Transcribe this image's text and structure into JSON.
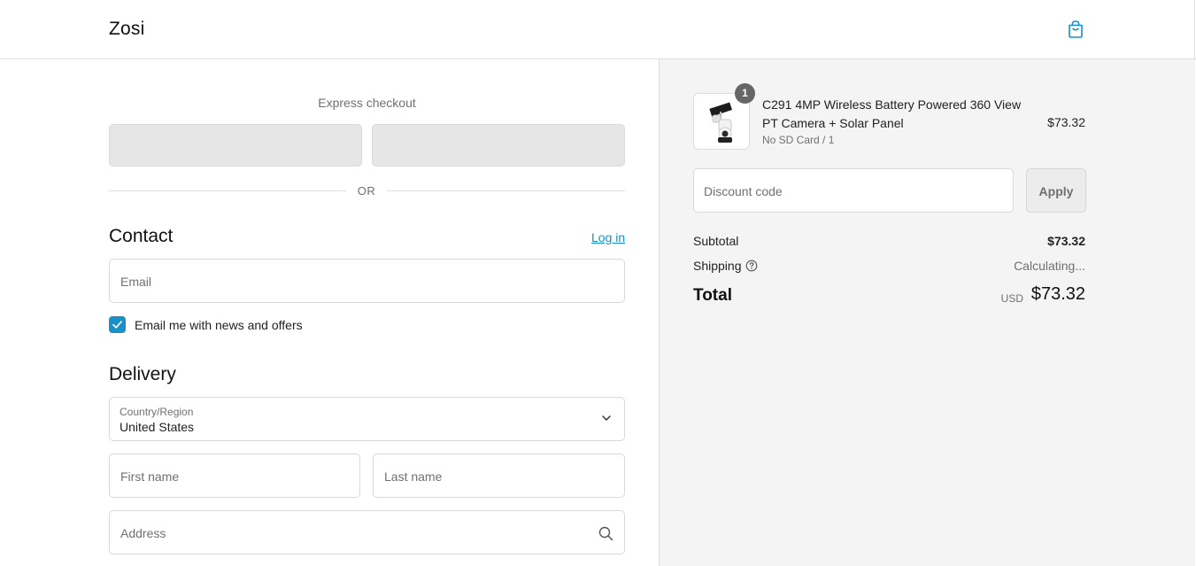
{
  "header": {
    "brand": "Zosi",
    "cart_icon": "shopping-bag-icon"
  },
  "express": {
    "title": "Express checkout",
    "divider_text": "OR"
  },
  "contact": {
    "title": "Contact",
    "login_link": "Log in",
    "email_placeholder": "Email",
    "newsletter_label": "Email me with news and offers",
    "newsletter_checked": true
  },
  "delivery": {
    "title": "Delivery",
    "country_label": "Country/Region",
    "country_value": "United States",
    "first_name_placeholder": "First name",
    "last_name_placeholder": "Last name",
    "address_placeholder": "Address"
  },
  "summary": {
    "item": {
      "quantity": "1",
      "title": "C291 4MP Wireless Battery Powered 360 View PT Camera + Solar Panel",
      "variant": "No SD Card / 1",
      "price": "$73.32"
    },
    "discount_placeholder": "Discount code",
    "apply_label": "Apply",
    "subtotal_label": "Subtotal",
    "subtotal_value": "$73.32",
    "shipping_label": "Shipping",
    "shipping_value": "Calculating...",
    "total_label": "Total",
    "currency": "USD",
    "total_value": "$73.32"
  },
  "colors": {
    "accent": "#1990c6",
    "panel_bg": "#f4f4f4"
  }
}
